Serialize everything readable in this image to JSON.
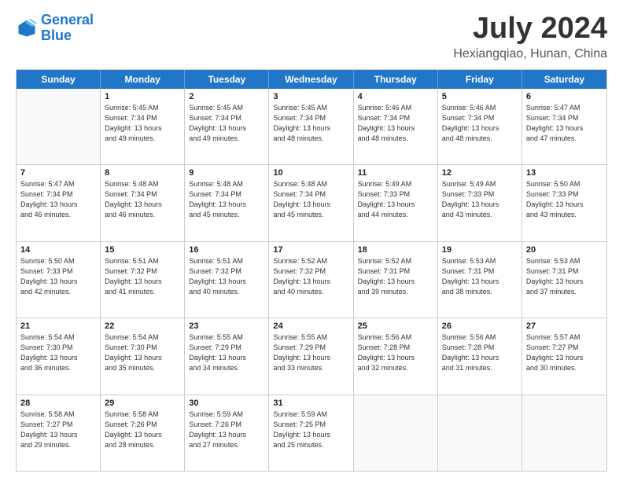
{
  "logo": {
    "line1": "General",
    "line2": "Blue"
  },
  "title": "July 2024",
  "location": "Hexiangqiao, Hunan, China",
  "header_days": [
    "Sunday",
    "Monday",
    "Tuesday",
    "Wednesday",
    "Thursday",
    "Friday",
    "Saturday"
  ],
  "weeks": [
    [
      {
        "day": "",
        "info": ""
      },
      {
        "day": "1",
        "info": "Sunrise: 5:45 AM\nSunset: 7:34 PM\nDaylight: 13 hours\nand 49 minutes."
      },
      {
        "day": "2",
        "info": "Sunrise: 5:45 AM\nSunset: 7:34 PM\nDaylight: 13 hours\nand 49 minutes."
      },
      {
        "day": "3",
        "info": "Sunrise: 5:45 AM\nSunset: 7:34 PM\nDaylight: 13 hours\nand 48 minutes."
      },
      {
        "day": "4",
        "info": "Sunrise: 5:46 AM\nSunset: 7:34 PM\nDaylight: 13 hours\nand 48 minutes."
      },
      {
        "day": "5",
        "info": "Sunrise: 5:46 AM\nSunset: 7:34 PM\nDaylight: 13 hours\nand 48 minutes."
      },
      {
        "day": "6",
        "info": "Sunrise: 5:47 AM\nSunset: 7:34 PM\nDaylight: 13 hours\nand 47 minutes."
      }
    ],
    [
      {
        "day": "7",
        "info": "Sunrise: 5:47 AM\nSunset: 7:34 PM\nDaylight: 13 hours\nand 46 minutes."
      },
      {
        "day": "8",
        "info": "Sunrise: 5:48 AM\nSunset: 7:34 PM\nDaylight: 13 hours\nand 46 minutes."
      },
      {
        "day": "9",
        "info": "Sunrise: 5:48 AM\nSunset: 7:34 PM\nDaylight: 13 hours\nand 45 minutes."
      },
      {
        "day": "10",
        "info": "Sunrise: 5:48 AM\nSunset: 7:34 PM\nDaylight: 13 hours\nand 45 minutes."
      },
      {
        "day": "11",
        "info": "Sunrise: 5:49 AM\nSunset: 7:33 PM\nDaylight: 13 hours\nand 44 minutes."
      },
      {
        "day": "12",
        "info": "Sunrise: 5:49 AM\nSunset: 7:33 PM\nDaylight: 13 hours\nand 43 minutes."
      },
      {
        "day": "13",
        "info": "Sunrise: 5:50 AM\nSunset: 7:33 PM\nDaylight: 13 hours\nand 43 minutes."
      }
    ],
    [
      {
        "day": "14",
        "info": "Sunrise: 5:50 AM\nSunset: 7:33 PM\nDaylight: 13 hours\nand 42 minutes."
      },
      {
        "day": "15",
        "info": "Sunrise: 5:51 AM\nSunset: 7:32 PM\nDaylight: 13 hours\nand 41 minutes."
      },
      {
        "day": "16",
        "info": "Sunrise: 5:51 AM\nSunset: 7:32 PM\nDaylight: 13 hours\nand 40 minutes."
      },
      {
        "day": "17",
        "info": "Sunrise: 5:52 AM\nSunset: 7:32 PM\nDaylight: 13 hours\nand 40 minutes."
      },
      {
        "day": "18",
        "info": "Sunrise: 5:52 AM\nSunset: 7:31 PM\nDaylight: 13 hours\nand 39 minutes."
      },
      {
        "day": "19",
        "info": "Sunrise: 5:53 AM\nSunset: 7:31 PM\nDaylight: 13 hours\nand 38 minutes."
      },
      {
        "day": "20",
        "info": "Sunrise: 5:53 AM\nSunset: 7:31 PM\nDaylight: 13 hours\nand 37 minutes."
      }
    ],
    [
      {
        "day": "21",
        "info": "Sunrise: 5:54 AM\nSunset: 7:30 PM\nDaylight: 13 hours\nand 36 minutes."
      },
      {
        "day": "22",
        "info": "Sunrise: 5:54 AM\nSunset: 7:30 PM\nDaylight: 13 hours\nand 35 minutes."
      },
      {
        "day": "23",
        "info": "Sunrise: 5:55 AM\nSunset: 7:29 PM\nDaylight: 13 hours\nand 34 minutes."
      },
      {
        "day": "24",
        "info": "Sunrise: 5:55 AM\nSunset: 7:29 PM\nDaylight: 13 hours\nand 33 minutes."
      },
      {
        "day": "25",
        "info": "Sunrise: 5:56 AM\nSunset: 7:28 PM\nDaylight: 13 hours\nand 32 minutes."
      },
      {
        "day": "26",
        "info": "Sunrise: 5:56 AM\nSunset: 7:28 PM\nDaylight: 13 hours\nand 31 minutes."
      },
      {
        "day": "27",
        "info": "Sunrise: 5:57 AM\nSunset: 7:27 PM\nDaylight: 13 hours\nand 30 minutes."
      }
    ],
    [
      {
        "day": "28",
        "info": "Sunrise: 5:58 AM\nSunset: 7:27 PM\nDaylight: 13 hours\nand 29 minutes."
      },
      {
        "day": "29",
        "info": "Sunrise: 5:58 AM\nSunset: 7:26 PM\nDaylight: 13 hours\nand 28 minutes."
      },
      {
        "day": "30",
        "info": "Sunrise: 5:59 AM\nSunset: 7:26 PM\nDaylight: 13 hours\nand 27 minutes."
      },
      {
        "day": "31",
        "info": "Sunrise: 5:59 AM\nSunset: 7:25 PM\nDaylight: 13 hours\nand 25 minutes."
      },
      {
        "day": "",
        "info": ""
      },
      {
        "day": "",
        "info": ""
      },
      {
        "day": "",
        "info": ""
      }
    ]
  ]
}
